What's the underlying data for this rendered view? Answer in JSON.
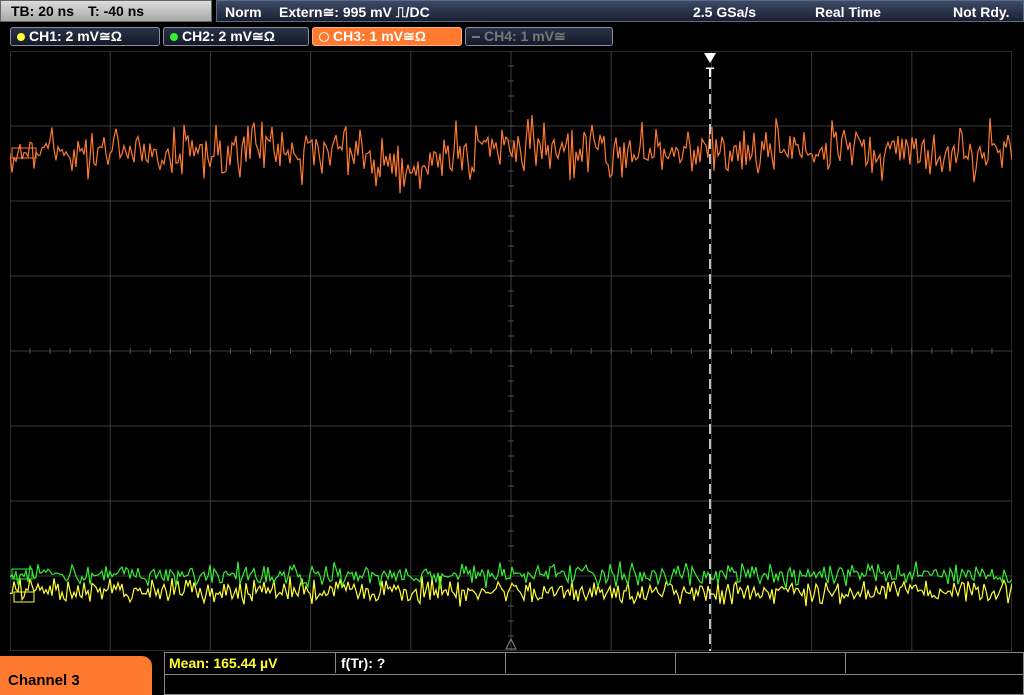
{
  "timebase": {
    "tb_label": "TB: 20 ns",
    "t_label": "T: -40 ns"
  },
  "status": {
    "mode": "Norm",
    "trigger": "Extern≅: 995 mV ⎍/DC",
    "sample_rate": "2.5 GSa/s",
    "acq_mode": "Real Time",
    "state": "Not Rdy."
  },
  "channels": [
    {
      "label": "CH1: 2 mV≅Ω",
      "color": "#ffff33"
    },
    {
      "label": "CH2: 2 mV≅Ω",
      "color": "#33ee33"
    },
    {
      "label": "CH3: 1 mV≅Ω",
      "color": "#ff7a2e"
    },
    {
      "label": "CH4: 1 mV≅",
      "color": "#777777"
    }
  ],
  "trigger_marker": "T",
  "bottom": {
    "active_channel": "Channel 3",
    "mean": "Mean: 165.44 µV",
    "ftr": "f(Tr): ?"
  },
  "colors": {
    "grid": "#3a3a3a",
    "ch1": "#ffff33",
    "ch2": "#33ee33",
    "ch3": "#ff7a2e"
  }
}
